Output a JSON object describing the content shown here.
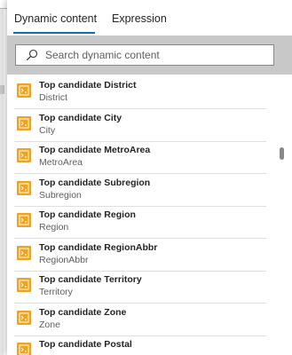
{
  "tabs": {
    "dynamic_content": "Dynamic content",
    "expression": "Expression"
  },
  "search": {
    "placeholder": "Search dynamic content",
    "value": ""
  },
  "colors": {
    "accent": "#0f6cbd",
    "item_icon": "#f3a31b",
    "search_band": "#c8c8c8"
  },
  "items": [
    {
      "title": "Top candidate District",
      "subtitle": "District",
      "icon": "variable-icon"
    },
    {
      "title": "Top candidate City",
      "subtitle": "City",
      "icon": "variable-icon"
    },
    {
      "title": "Top candidate MetroArea",
      "subtitle": "MetroArea",
      "icon": "variable-icon"
    },
    {
      "title": "Top candidate Subregion",
      "subtitle": "Subregion",
      "icon": "variable-icon"
    },
    {
      "title": "Top candidate Region",
      "subtitle": "Region",
      "icon": "variable-icon"
    },
    {
      "title": "Top candidate RegionAbbr",
      "subtitle": "RegionAbbr",
      "icon": "variable-icon"
    },
    {
      "title": "Top candidate Territory",
      "subtitle": "Territory",
      "icon": "variable-icon"
    },
    {
      "title": "Top candidate Zone",
      "subtitle": "Zone",
      "icon": "variable-icon"
    },
    {
      "title": "Top candidate Postal",
      "subtitle": "",
      "icon": "variable-icon"
    }
  ]
}
